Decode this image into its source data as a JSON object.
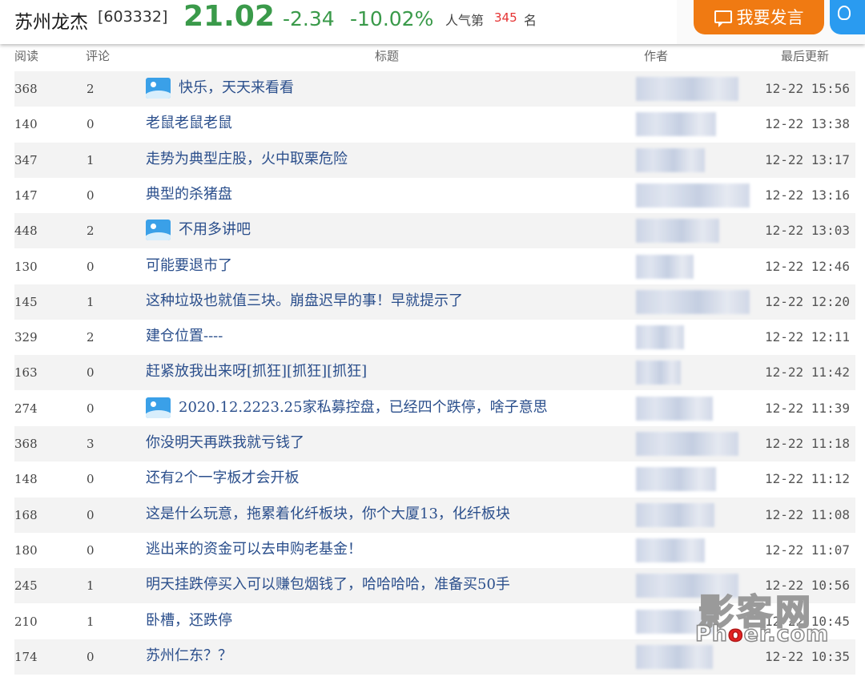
{
  "header": {
    "stock_name": "苏州龙杰",
    "stock_code": "[603332]",
    "price": "21.02",
    "change": "-2.34",
    "change_pct": "-10.02%",
    "popularity_label": "人气第",
    "popularity_rank": "345",
    "popularity_unit": "名",
    "post_button_label": "我要发言",
    "price_color": "#3a9a4a",
    "post_button_color": "#f07a12"
  },
  "columns": {
    "read": "阅读",
    "comment": "评论",
    "title": "标题",
    "author": "作者",
    "updated": "最后更新"
  },
  "rows": [
    {
      "read": "368",
      "comment": "2",
      "title": "快乐，天天来看看",
      "image": true,
      "time": "12-22 15:56"
    },
    {
      "read": "140",
      "comment": "0",
      "title": "老鼠老鼠老鼠",
      "image": false,
      "time": "12-22 13:38"
    },
    {
      "read": "347",
      "comment": "1",
      "title": "走势为典型庄股，火中取栗危险",
      "image": false,
      "time": "12-22 13:17"
    },
    {
      "read": "147",
      "comment": "0",
      "title": "典型的杀猪盘",
      "image": false,
      "time": "12-22 13:16"
    },
    {
      "read": "448",
      "comment": "2",
      "title": "不用多讲吧",
      "image": true,
      "time": "12-22 13:03"
    },
    {
      "read": "130",
      "comment": "0",
      "title": "可能要退市了",
      "image": false,
      "time": "12-22 12:46"
    },
    {
      "read": "145",
      "comment": "1",
      "title": "这种垃圾也就值三块。崩盘迟早的事！早就提示了",
      "image": false,
      "time": "12-22 12:20"
    },
    {
      "read": "329",
      "comment": "2",
      "title": "建仓位置----",
      "image": false,
      "time": "12-22 12:11"
    },
    {
      "read": "163",
      "comment": "0",
      "title": "赶紧放我出来呀[抓狂][抓狂][抓狂]",
      "image": false,
      "time": "12-22 11:42"
    },
    {
      "read": "274",
      "comment": "0",
      "title": "2020.12.2223.25家私募控盘，已经四个跌停，啥子意思",
      "image": true,
      "time": "12-22 11:39"
    },
    {
      "read": "368",
      "comment": "3",
      "title": "你没明天再跌我就亏钱了",
      "image": false,
      "time": "12-22 11:18"
    },
    {
      "read": "148",
      "comment": "0",
      "title": "还有2个一字板才会开板",
      "image": false,
      "time": "12-22 11:12"
    },
    {
      "read": "168",
      "comment": "0",
      "title": "这是什么玩意，拖累着化纤板块，你个大厦13，化纤板块",
      "image": false,
      "time": "12-22 11:08"
    },
    {
      "read": "180",
      "comment": "0",
      "title": "逃出来的资金可以去申购老基金！",
      "image": false,
      "time": "12-22 11:07"
    },
    {
      "read": "245",
      "comment": "1",
      "title": "明天挂跌停买入可以赚包烟钱了，哈哈哈哈，准备买50手",
      "image": false,
      "time": "12-22 10:56"
    },
    {
      "read": "210",
      "comment": "1",
      "title": "卧槽，还跌停",
      "image": false,
      "time": "12-22 10:45"
    },
    {
      "read": "174",
      "comment": "0",
      "title": "苏州仁东？？",
      "image": false,
      "time": "12-22 10:35"
    }
  ],
  "watermark": {
    "cn": "影客网",
    "en_prefix": "Ph",
    "en_accent": "o",
    "en_suffix": "er.com"
  }
}
